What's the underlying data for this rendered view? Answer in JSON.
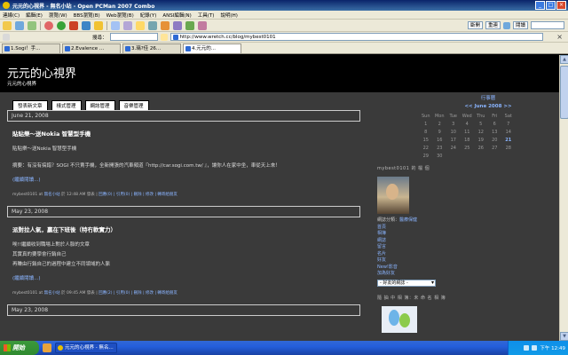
{
  "window": {
    "title": "元元的心視界 - 無名小站 - Open PCMan 2007 Combo"
  },
  "menu": [
    "連線(C)",
    "編輯(E)",
    "瀏覽(W)",
    "BBS瀏覽(B)",
    "Web瀏覽(B)",
    "紀錄(Y)",
    "ANSI編輯(N)",
    "工具(T)",
    "說明(H)"
  ],
  "toolbar": {
    "btn_a": "斷開",
    "btn_b": "重連",
    "btn_c": "閱讀"
  },
  "address": {
    "search_label": "搜尋：",
    "url": "http://www.wretch.cc/blog/mybest0101"
  },
  "tabs": [
    "1.Sogi！手...",
    "2.Evalence ...",
    "3.璃?佳 26...",
    "4.元元的..."
  ],
  "blog": {
    "title": "元元的心視界",
    "subtitle": "元元的心視界",
    "nav": [
      "發表新文章",
      "樣式管理",
      "網誌管理",
      "音樂管理"
    ]
  },
  "posts": [
    {
      "date": "June 21, 2008",
      "title": "貼貼樂～送Nokia 智慧型手機",
      "lines": [
        "貼貼樂～送Nokia 智慧型手機"
      ],
      "body2": "摘要：有沒有搞錯？SOGI 不只賣手機，全新開張的汽車頻道『http://car.sogi.com.tw/ 』，讓你人在家中坐，車從天上來！",
      "more": "(繼續閱讀...)",
      "foot_author": "mybest0101 at ",
      "foot_author_link": "無名小站",
      "foot_time": " 於 12:48 AM 發表 | ",
      "foot_links": "回應(0) | 引用(0) | 刪除 | 修改 | 轉寄給朋友"
    },
    {
      "date": "May 23, 2008",
      "title": "派對拉人氣，贏在下班後（特冇軟實力）",
      "lines": [
        "唉!!繼續收到職場上對於人脈的文章",
        "其實真的要學會行銷自己",
        "再賺由行銷自己的過程中建立不同領域的人脈"
      ],
      "more": "(繼續閱讀...)",
      "foot_author": "mybest0101 at ",
      "foot_author_link": "無名小站",
      "foot_time": " 於 09:45 AM 發表 | ",
      "foot_links": "回應(2) | 引用(0) | 刪除 | 修改 | 轉寄給朋友"
    }
  ],
  "last_date": "May 23, 2008",
  "sidebar": {
    "cal_nav": "行事曆",
    "cal_month": "<< June 2008 >>",
    "cal_head": [
      "Sun",
      "Mon",
      "Tue",
      "Wed",
      "Thu",
      "Fri",
      "Sat"
    ],
    "cal_rows": [
      [
        "1",
        "2",
        "3",
        "4",
        "5",
        "6",
        "7"
      ],
      [
        "8",
        "9",
        "10",
        "11",
        "12",
        "13",
        "14"
      ],
      [
        "15",
        "16",
        "17",
        "18",
        "19",
        "20",
        "21"
      ],
      [
        "22",
        "23",
        "24",
        "25",
        "26",
        "27",
        "28"
      ],
      [
        "29",
        "30",
        "",
        "",
        "",
        "",
        ""
      ]
    ],
    "cal_highlight": "21",
    "profile_head": "mybest0101 的 檔 個",
    "cat_label": "網誌分類：",
    "cat_link": "醫療保健",
    "links": [
      "首頁",
      "相簿",
      "網誌",
      "留言",
      "名片",
      "好友",
      "New!影音",
      "加為好友"
    ],
    "select_label": "- 好友的網誌 -",
    "msn_head": "隨 抽 中 相 簿：未 命 名 相 簿"
  },
  "taskbar": {
    "start": "開始",
    "task": "元元的心視界 - 無名...",
    "clock": "下午 12:49"
  }
}
